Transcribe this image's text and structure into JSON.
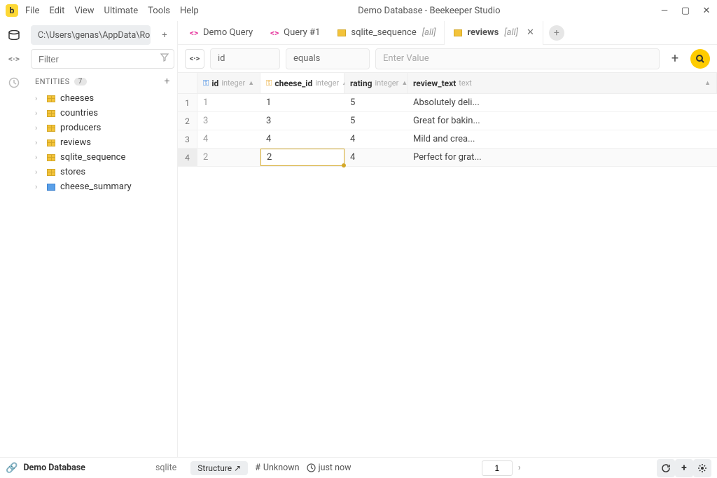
{
  "window": {
    "title": "Demo Database - Beekeeper Studio",
    "menu": [
      "File",
      "Edit",
      "View",
      "Ultimate",
      "Tools",
      "Help"
    ]
  },
  "sidebar": {
    "connection_path": "C:\\Users\\genas\\AppData\\Ro...",
    "filter_placeholder": "Filter",
    "entities_label": "ENTITIES",
    "entities_count": "7",
    "entities": [
      {
        "name": "cheeses",
        "type": "table"
      },
      {
        "name": "countries",
        "type": "table"
      },
      {
        "name": "producers",
        "type": "table"
      },
      {
        "name": "reviews",
        "type": "table"
      },
      {
        "name": "sqlite_sequence",
        "type": "table"
      },
      {
        "name": "stores",
        "type": "table"
      },
      {
        "name": "cheese_summary",
        "type": "view"
      }
    ]
  },
  "tabs": [
    {
      "kind": "query",
      "label": "Demo Query"
    },
    {
      "kind": "query",
      "label": "Query #1"
    },
    {
      "kind": "table",
      "label": "sqlite_sequence",
      "suffix": "[all]"
    },
    {
      "kind": "table",
      "label": "reviews",
      "suffix": "[all]",
      "active": true,
      "closable": true
    }
  ],
  "filter": {
    "field": "id",
    "operator": "equals",
    "value_placeholder": "Enter Value"
  },
  "columns": [
    {
      "name": "id",
      "type": "integer",
      "key": "pk"
    },
    {
      "name": "cheese_id",
      "type": "integer",
      "key": "fk",
      "active": true
    },
    {
      "name": "rating",
      "type": "integer"
    },
    {
      "name": "review_text",
      "type": "text"
    }
  ],
  "rows": [
    {
      "n": "1",
      "id": "1",
      "cheese_id": "1",
      "rating": "5",
      "review_text": "Absolutely deli..."
    },
    {
      "n": "2",
      "id": "3",
      "cheese_id": "3",
      "rating": "5",
      "review_text": "Great for bakin..."
    },
    {
      "n": "3",
      "id": "4",
      "cheese_id": "4",
      "rating": "4",
      "review_text": "Mild and crea..."
    },
    {
      "n": "4",
      "id": "2",
      "cheese_id": "2",
      "rating": "4",
      "review_text": "Perfect for grat...",
      "selected": true,
      "editing_col": "cheese_id"
    }
  ],
  "status": {
    "connection": "Demo Database",
    "dbtype": "sqlite",
    "structure_label": "Structure ↗",
    "unknown_label": "Unknown",
    "time_label": "just now",
    "page": "1"
  }
}
